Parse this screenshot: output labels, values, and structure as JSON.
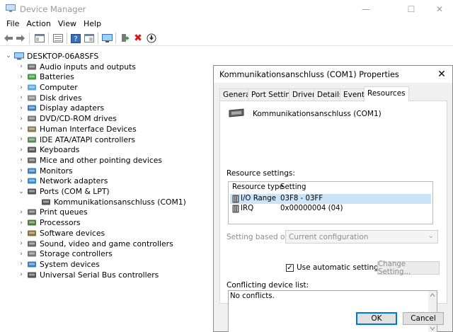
{
  "window": {
    "title": "Device Manager",
    "minimize_glyph": "—",
    "maximize_glyph": "☐",
    "close_glyph": "✕"
  },
  "menu": [
    "File",
    "Action",
    "View",
    "Help"
  ],
  "toolbar": {
    "icons": [
      "back-icon",
      "forward-icon",
      "properties-view-icon",
      "device-list-icon",
      "help-icon",
      "resource-view-icon",
      "monitor-scan-icon",
      "add-driver-icon",
      "uninstall-icon",
      "update-driver-icon"
    ],
    "uninstall_glyph": "✖",
    "down_glyph": "⬇"
  },
  "tree": {
    "root": "DESKTOP-06A8SFS",
    "items": [
      {
        "label": "Audio inputs and outputs",
        "icon": "speaker-icon",
        "expanded": false
      },
      {
        "label": "Batteries",
        "icon": "battery-icon",
        "expanded": false
      },
      {
        "label": "Computer",
        "icon": "computer-icon",
        "expanded": false
      },
      {
        "label": "Disk drives",
        "icon": "disk-drive-icon",
        "expanded": false
      },
      {
        "label": "Display adapters",
        "icon": "display-adapter-icon",
        "expanded": false
      },
      {
        "label": "DVD/CD-ROM drives",
        "icon": "dvd-drive-icon",
        "expanded": false
      },
      {
        "label": "Human Interface Devices",
        "icon": "hid-icon",
        "expanded": false
      },
      {
        "label": "IDE ATA/ATAPI controllers",
        "icon": "ide-controller-icon",
        "expanded": false
      },
      {
        "label": "Keyboards",
        "icon": "keyboard-icon",
        "expanded": false
      },
      {
        "label": "Mice and other pointing devices",
        "icon": "mouse-icon",
        "expanded": false
      },
      {
        "label": "Monitors",
        "icon": "monitor-icon",
        "expanded": false
      },
      {
        "label": "Network adapters",
        "icon": "network-adapter-icon",
        "expanded": false
      },
      {
        "label": "Ports (COM & LPT)",
        "icon": "port-icon",
        "expanded": true
      },
      {
        "label": "Kommunikationsanschluss (COM1)",
        "icon": "com-port-icon",
        "child": true
      },
      {
        "label": "Print queues",
        "icon": "printer-icon",
        "expanded": false
      },
      {
        "label": "Processors",
        "icon": "processor-icon",
        "expanded": false
      },
      {
        "label": "Software devices",
        "icon": "software-device-icon",
        "expanded": false
      },
      {
        "label": "Sound, video and game controllers",
        "icon": "sound-controller-icon",
        "expanded": false
      },
      {
        "label": "Storage controllers",
        "icon": "storage-controller-icon",
        "expanded": false
      },
      {
        "label": "System devices",
        "icon": "system-device-icon",
        "expanded": false
      },
      {
        "label": "Universal Serial Bus controllers",
        "icon": "usb-icon",
        "expanded": false
      }
    ]
  },
  "dialog": {
    "title": "Kommunikationsanschluss (COM1) Properties",
    "close_glyph": "✕",
    "tabs": [
      "General",
      "Port Settings",
      "Driver",
      "Details",
      "Events",
      "Resources"
    ],
    "active_tab": "Resources",
    "device_name": "Kommunikationsanschluss (COM1)",
    "resource_settings_label": "Resource settings:",
    "resource_columns": [
      "Resource type",
      "Setting"
    ],
    "resources": [
      {
        "type": "I/O Range",
        "setting": "03F8 - 03FF",
        "selected": true
      },
      {
        "type": "IRQ",
        "setting": "0x00000004 (04)",
        "selected": false
      }
    ],
    "setting_based_on_label": "Setting based on:",
    "setting_based_on_value": "Current configuration",
    "use_automatic_label": "Use automatic settings",
    "use_automatic_checked": true,
    "check_glyph": "✓",
    "change_setting_label": "Change Setting...",
    "conflict_label": "Conflicting device list:",
    "conflict_text": "No conflicts.",
    "ok_label": "OK",
    "cancel_label": "Cancel"
  }
}
